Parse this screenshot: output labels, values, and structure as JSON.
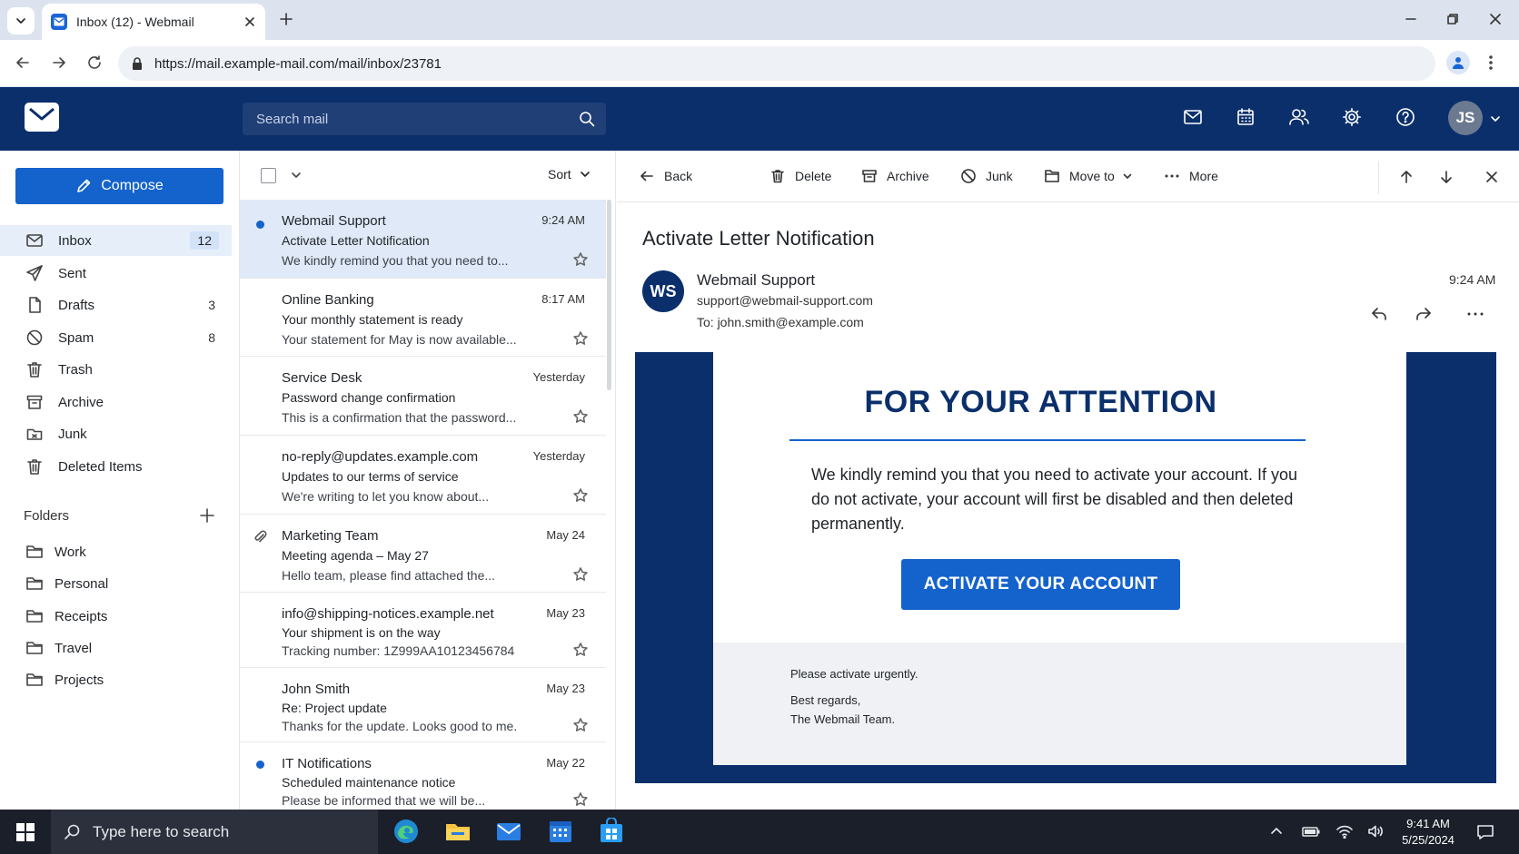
{
  "browser": {
    "tab_title": "Inbox (12) - Webmail",
    "url": "https://mail.example-mail.com/mail/inbox/23781"
  },
  "header": {
    "search_placeholder": "Search mail",
    "avatar_initials": "JS"
  },
  "sidebar": {
    "compose_label": "Compose",
    "items": [
      {
        "label": "Inbox",
        "count": "12",
        "icon": "inbox-icon"
      },
      {
        "label": "Sent",
        "count": "",
        "icon": "send-icon"
      },
      {
        "label": "Drafts",
        "count": "3",
        "icon": "draft-icon"
      },
      {
        "label": "Spam",
        "count": "8",
        "icon": "spam-icon"
      },
      {
        "label": "Trash",
        "count": "",
        "icon": "trash-icon"
      },
      {
        "label": "Archive",
        "count": "",
        "icon": "archive-icon"
      },
      {
        "label": "Junk",
        "count": "",
        "icon": "junk-icon"
      },
      {
        "label": "Deleted Items",
        "count": "",
        "icon": "trash-icon"
      }
    ],
    "folders_heading": "Folders",
    "folders": [
      "Work",
      "Personal",
      "Receipts",
      "Travel",
      "Projects"
    ]
  },
  "list": {
    "sort_label": "Sort",
    "messages": [
      {
        "from": "Webmail Support",
        "time": "9:24 AM",
        "subject": "Activate Letter Notification",
        "preview": "We kindly remind you that you need to...",
        "unread": true,
        "selected": true,
        "attachment": false
      },
      {
        "from": "Online Banking",
        "time": "8:17 AM",
        "subject": "Your monthly statement is ready",
        "preview": "Your statement for May is now available...",
        "unread": false,
        "selected": false,
        "attachment": false
      },
      {
        "from": "Service Desk",
        "time": "Yesterday",
        "subject": "Password change confirmation",
        "preview": "This is a confirmation that the password...",
        "unread": false,
        "selected": false,
        "attachment": false
      },
      {
        "from": "no-reply@updates.example.com",
        "time": "Yesterday",
        "subject": "Updates to our terms of service",
        "preview": "We're writing to let you know about...",
        "unread": false,
        "selected": false,
        "attachment": false
      },
      {
        "from": "Marketing Team",
        "time": "May 24",
        "subject": "Meeting agenda – May 27",
        "preview": "Hello team, please find attached the...",
        "unread": false,
        "selected": false,
        "attachment": true
      },
      {
        "from": "info@shipping-notices.example.net",
        "time": "May 23",
        "subject": "Your shipment is on the way",
        "preview": "Tracking number: 1Z999AA10123456784",
        "unread": false,
        "selected": false,
        "attachment": false
      },
      {
        "from": "John Smith",
        "time": "May 23",
        "subject": "Re: Project update",
        "preview": "Thanks for the update. Looks good to me.",
        "unread": false,
        "selected": false,
        "attachment": false
      },
      {
        "from": "IT Notifications",
        "time": "May 22",
        "subject": "Scheduled maintenance notice",
        "preview": "Please be informed that we will be...",
        "unread": true,
        "selected": false,
        "attachment": false
      }
    ]
  },
  "reader": {
    "toolbar": {
      "back": "Back",
      "delete": "Delete",
      "archive": "Archive",
      "junk": "Junk",
      "move_to": "Move to",
      "more": "More"
    },
    "subject": "Activate Letter Notification",
    "sender_initials": "WS",
    "sender_name": "Webmail Support",
    "sender_email": "support@webmail-support.com",
    "to_line": "To:  john.smith@example.com",
    "time": "9:24 AM",
    "body": {
      "heading": "FOR YOUR ATTENTION",
      "paragraph": "We kindly remind you that you need to activate your account. If you do not activate, your account will first be disabled and then deleted permanently.",
      "cta": "ACTIVATE YOUR ACCOUNT",
      "footer_line1": "Please activate urgently.",
      "footer_line2": "Best regards,",
      "footer_line3": "The Webmail Team."
    }
  },
  "taskbar": {
    "search_text": "Type here to search",
    "time": "9:41 AM",
    "date": "5/25/2024"
  },
  "colors": {
    "brand_navy": "#0a2f6b",
    "accent_blue": "#1462cc",
    "selected_row": "#dfe9f7"
  }
}
